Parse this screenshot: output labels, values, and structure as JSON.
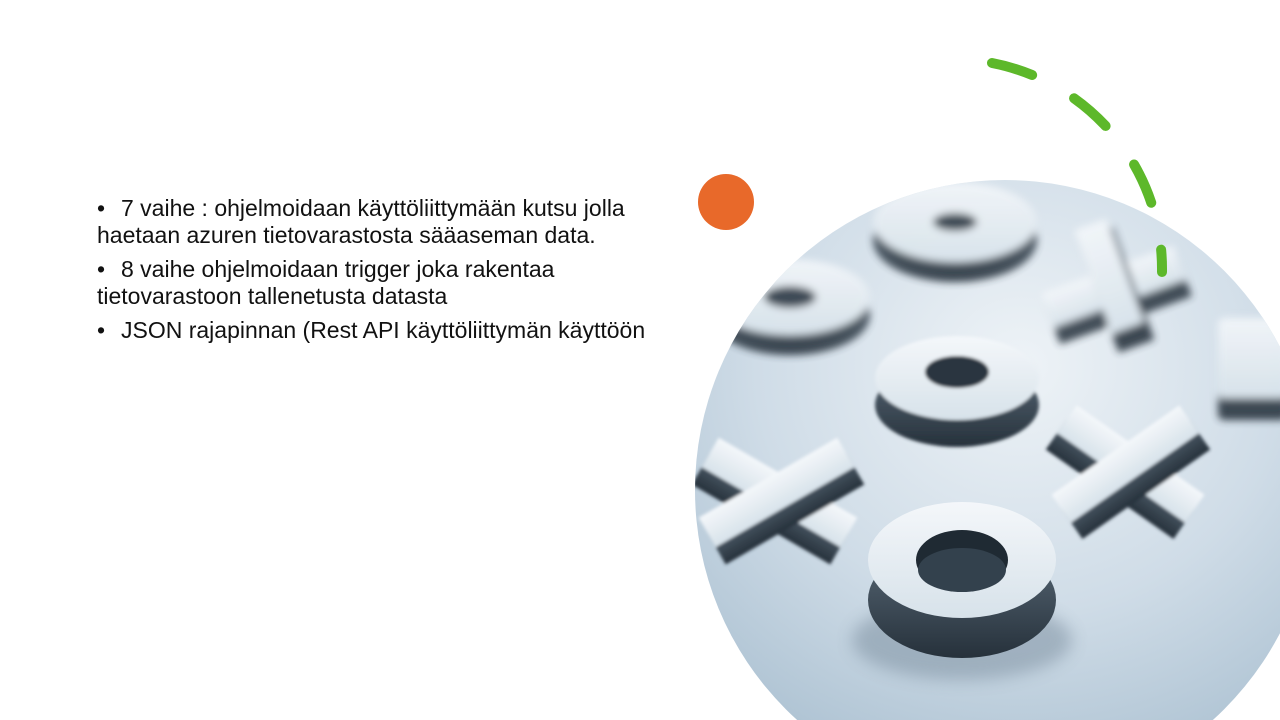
{
  "slide": {
    "bullets": [
      {
        "marker": "•",
        "text": "7 vaihe :  ohjelmoidaan käyttöliittymään kutsu jolla haetaan azuren tietovarastosta sääaseman data."
      },
      {
        "marker": "•",
        "text": "8 vaihe ohjelmoidaan trigger joka rakentaa tietovarastoon tallenetusta datasta"
      },
      {
        "marker": "•",
        "text": "JSON rajapinnan (Rest API käyttöliittymän käyttöön"
      }
    ]
  },
  "colors": {
    "accent_orange": "#E8692A",
    "accent_green": "#5DB82A",
    "photo_base": "#c9d8e4",
    "piece_dark": "#3a4754"
  },
  "icons": {
    "orange_dot": "orange-circle-icon",
    "green_arc": "dashed-arc-icon"
  }
}
